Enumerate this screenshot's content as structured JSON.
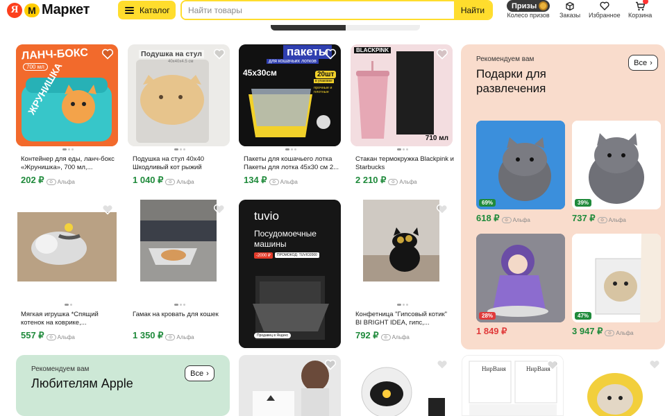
{
  "header": {
    "logo_ya": "Я",
    "logo_m": "М",
    "logo_text": "Маркет",
    "catalog_label": "Каталог",
    "search_placeholder": "Найти товары",
    "search_button": "Найти",
    "nav": [
      {
        "label": "Колесо призов",
        "icon": "prize-wheel-icon",
        "pill": "Призы"
      },
      {
        "label": "Заказы",
        "icon": "box-icon"
      },
      {
        "label": "Избранное",
        "icon": "heart-icon"
      },
      {
        "label": "Корзина",
        "icon": "cart-icon"
      }
    ]
  },
  "products": [
    {
      "title": "Контейнер для еды, ланч-бокс «Жрунишка», 700 мл,...",
      "price": "202 ₽",
      "alfa": "Альфа",
      "img_text": "ЛАНЧ-БОКС",
      "img_sub": "700 мл",
      "img_stamp": "ЖРУНИШКА"
    },
    {
      "title": "Подушка на стул 40х40 Шкодливый кот рыжий",
      "price": "1 040 ₽",
      "alfa": "Альфа",
      "img_text": "Подушка на стул",
      "img_sub": "40x40x4.5 см"
    },
    {
      "title": "Пакеты для кошачьего лотка Пакеты для лотка 45х30 см 2...",
      "price": "134 ₽",
      "alfa": "Альфа",
      "img_text": "пакеты",
      "img_sub": "для кошачьих лотков",
      "img_size": "45х30см",
      "img_badge": "20шт",
      "img_badge_sub": "в упаковке",
      "img_feat": "прочные и плотные"
    },
    {
      "title": "Стакан термокружка Blackpink и Starbucks",
      "price": "2 210 ₽",
      "alfa": "Альфа",
      "img_brand": "BLACKPINK",
      "img_volume": "710 мл"
    },
    {
      "title": "Мягкая игрушка *Спящий котенок на коврике,...",
      "price": "557 ₽",
      "alfa": "Альфа"
    },
    {
      "title": "Гамак на кровать для кошек",
      "price": "1 350 ₽",
      "alfa": "Альфа"
    },
    {
      "title": "",
      "price": "",
      "alfa": "",
      "img_brand": "tuvio",
      "img_head": "Посудомоечные машины",
      "img_promo": "-2000 ₽",
      "img_code": "ПРОМОКОД: TUVIO2000",
      "img_seller": "Продавец в Яндекс"
    },
    {
      "title": "Конфетница \"Гипсовый котик\" BI BRIGHT IDEA, гипс,...",
      "price": "792 ₽",
      "alfa": "Альфа"
    }
  ],
  "gift_block": {
    "subtitle": "Рекомендуем вам",
    "heading": "Подарки для развлечения",
    "all_label": "Все",
    "items": [
      {
        "discount": "69%",
        "price": "618 ₽",
        "alfa": "Альфа",
        "price_color": "#1f8a3b"
      },
      {
        "discount": "39%",
        "price": "737 ₽",
        "alfa": "Альфа",
        "price_color": "#1f8a3b"
      },
      {
        "discount": "28%",
        "price": "1 849 ₽",
        "alfa": "",
        "price_color": "#e03a3a"
      },
      {
        "discount": "47%",
        "price": "3 947 ₽",
        "alfa": "Альфа",
        "price_color": "#1f8a3b"
      }
    ]
  },
  "apple_block": {
    "subtitle": "Рекомендуем вам",
    "heading": "Любителям Apple",
    "all_label": "Все"
  },
  "bottom_cards": [
    {
      "brand": ""
    },
    {
      "brand": ""
    },
    {
      "brand": "НирВаня"
    },
    {
      "brand": ""
    }
  ]
}
